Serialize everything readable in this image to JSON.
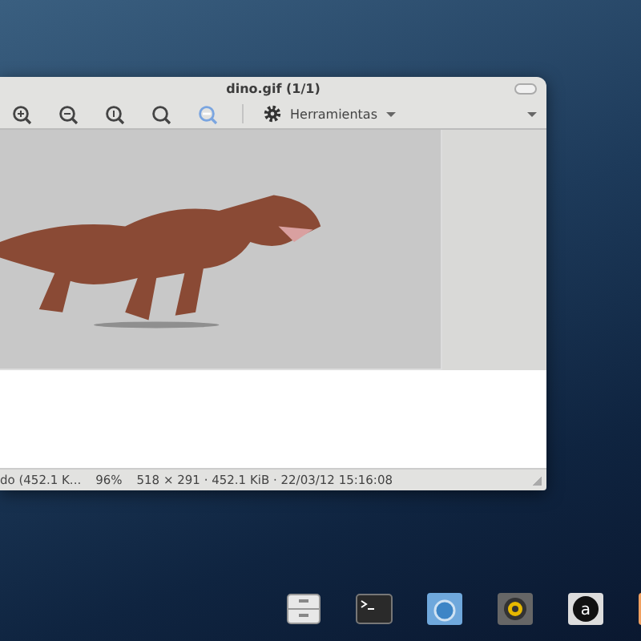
{
  "window": {
    "title": "dino.gif (1/1)"
  },
  "toolbar": {
    "tools": [
      {
        "kind": "zoom-in",
        "selected": false
      },
      {
        "kind": "zoom-out",
        "selected": false
      },
      {
        "kind": "zoom-original",
        "selected": false
      },
      {
        "kind": "zoom-fit",
        "selected": false
      },
      {
        "kind": "zoom-selection",
        "selected": true
      }
    ],
    "menu": {
      "label": "Herramientas"
    }
  },
  "status_bar": {
    "file": "do (452.1 K...",
    "zoom": "96%",
    "info": "518 × 291 · 452.1 KiB · 22/03/12 15:16:08"
  },
  "dock": [
    {
      "kind": "files"
    },
    {
      "kind": "terminal"
    },
    {
      "kind": "browser"
    },
    {
      "kind": "audio"
    },
    {
      "kind": "font",
      "glyph": "a"
    },
    {
      "kind": "partial"
    }
  ]
}
